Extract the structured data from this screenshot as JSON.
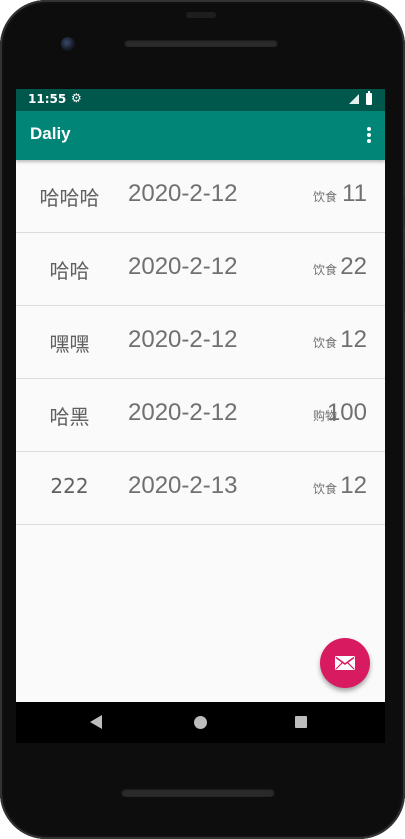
{
  "status_bar": {
    "time": "11:55",
    "settings_icon": "gear-icon",
    "signal_icon": "cell-signal-icon",
    "battery_icon": "battery-icon",
    "color": "#00574b"
  },
  "toolbar": {
    "title": "Daliy",
    "overflow_icon": "more-vert-icon",
    "color": "#008577"
  },
  "list": {
    "items": [
      {
        "name": "哈哈哈",
        "date": "2020-2-12",
        "type": "饮食",
        "amount": "11"
      },
      {
        "name": "哈哈",
        "date": "2020-2-12",
        "type": "饮食",
        "amount": "22"
      },
      {
        "name": "嘿嘿",
        "date": "2020-2-12",
        "type": "饮食",
        "amount": "12"
      },
      {
        "name": "哈黑",
        "date": "2020-2-12",
        "type": "购物",
        "amount": "100"
      },
      {
        "name": "222",
        "date": "2020-2-13",
        "type": "饮食",
        "amount": "12"
      }
    ]
  },
  "fab": {
    "icon": "mail-icon",
    "color": "#d81b60"
  },
  "nav_bar": {
    "back_icon": "back-icon",
    "home_icon": "home-icon",
    "recents_icon": "recents-icon"
  }
}
